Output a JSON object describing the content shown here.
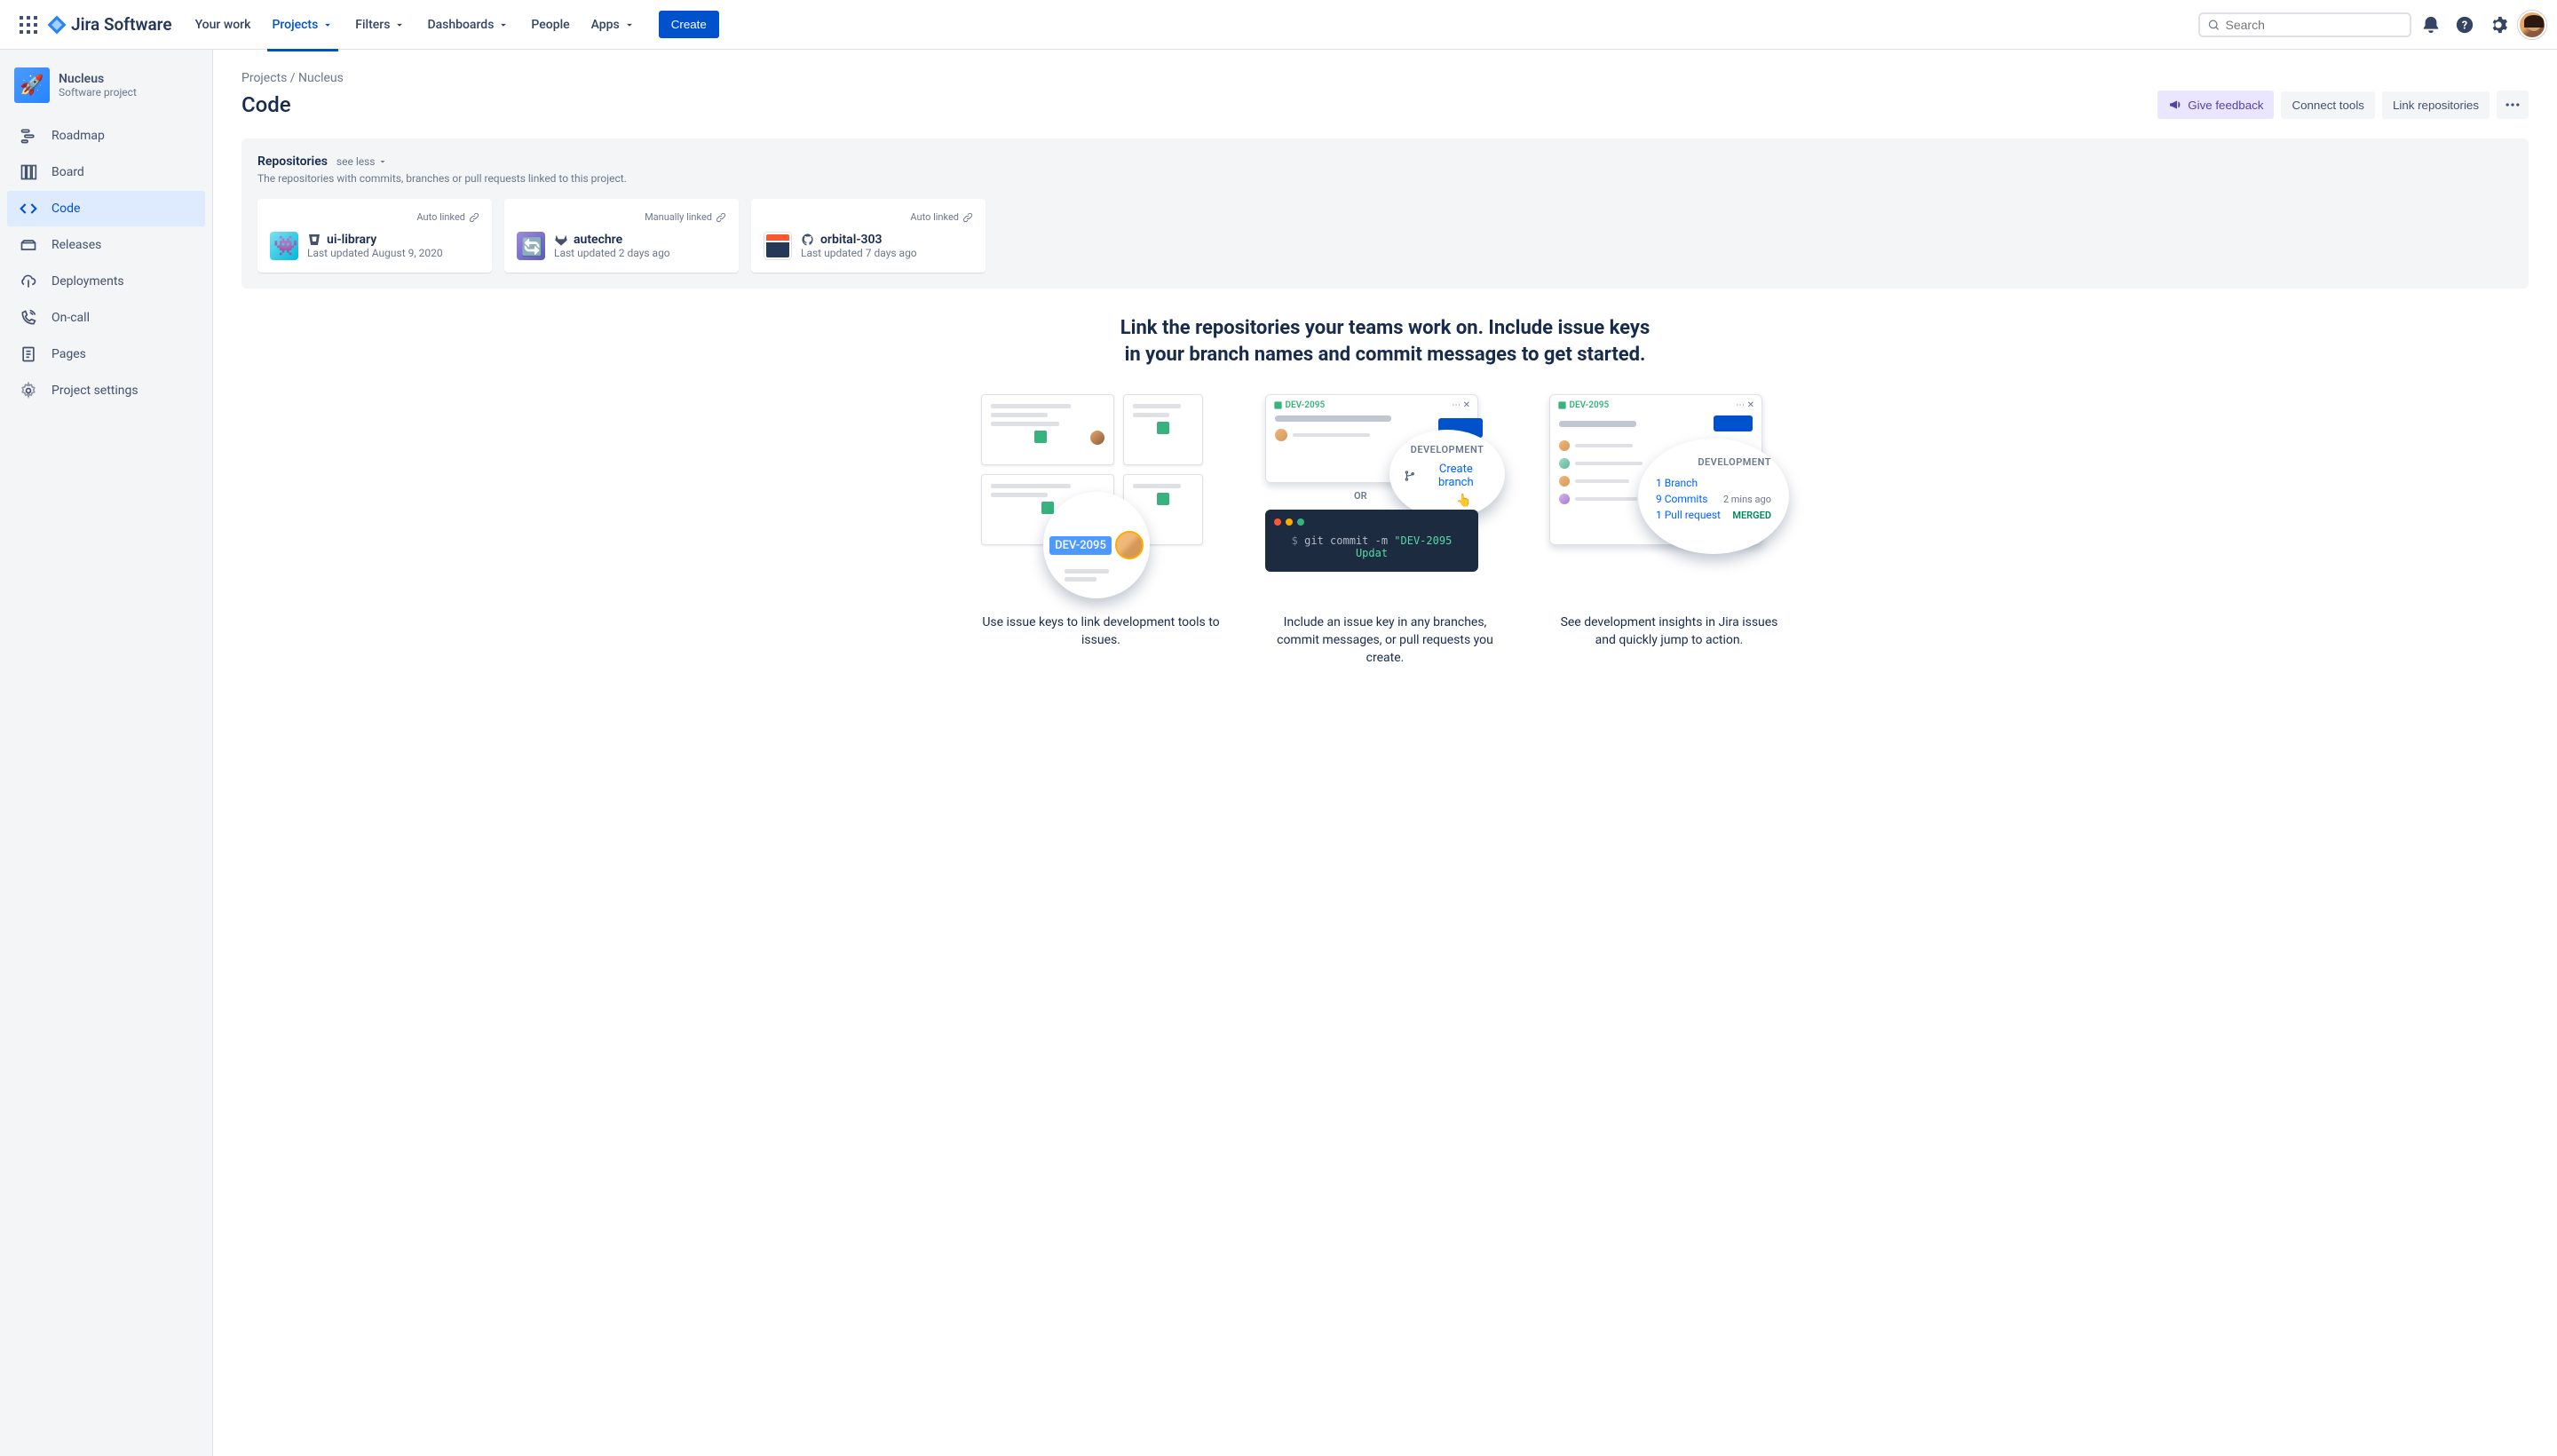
{
  "topnav": {
    "logo": "Jira Software",
    "items": [
      "Your work",
      "Projects",
      "Filters",
      "Dashboards",
      "People",
      "Apps"
    ],
    "create": "Create",
    "search_placeholder": "Search"
  },
  "sidebar": {
    "project_name": "Nucleus",
    "project_type": "Software project",
    "items": [
      "Roadmap",
      "Board",
      "Code",
      "Releases",
      "Deployments",
      "On-call",
      "Pages",
      "Project settings"
    ]
  },
  "breadcrumb": "Projects / Nucleus",
  "page_title": "Code",
  "actions": {
    "feedback": "Give feedback",
    "connect": "Connect tools",
    "link_repos": "Link repositories"
  },
  "repo_section": {
    "title": "Repositories",
    "see_less": "see less",
    "subtitle": "The repositories with commits, branches or pull requests linked to this project.",
    "cards": [
      {
        "link_type": "Auto linked",
        "name": "ui-library",
        "updated": "Last updated August 9, 2020"
      },
      {
        "link_type": "Manually linked",
        "name": "autechre",
        "updated": "Last updated 2 days ago"
      },
      {
        "link_type": "Auto linked",
        "name": "orbital-303",
        "updated": "Last updated 7 days ago"
      }
    ]
  },
  "cta_heading": "Link the repositories your teams work on. Include issue keys in your branch names and commit messages to get started.",
  "illustrations": {
    "issue_key": "DEV-2095",
    "create_branch": "Create branch",
    "development_label": "DEVELOPMENT",
    "or": "OR",
    "terminal_cmd": "$ git commit -m \"DEV-2095 Updat",
    "branch_count": "1 Branch",
    "commits_count": "9 Commits",
    "commits_time": "2 mins ago",
    "pr_count": "1 Pull request",
    "merged": "MERGED",
    "captions": [
      "Use issue keys to link development tools to issues.",
      "Include an issue key in any branches, commit messages, or pull requests you create.",
      "See development insights in Jira issues and quickly jump to action."
    ]
  }
}
